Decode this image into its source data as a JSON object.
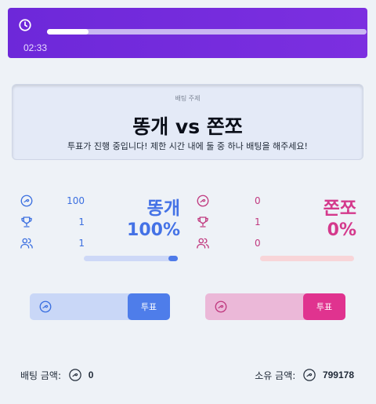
{
  "timer": {
    "remaining": "02:33",
    "progress": 0.13
  },
  "topic": {
    "label": "배팅 주제",
    "title": "똥개 vs 쫀쪼",
    "description": "투표가 진행 중입니다! 제한 시간 내에 둘 중 하나 배팅을 해주세요!"
  },
  "sides": {
    "left": {
      "name": "똥개",
      "percent": "100%",
      "coins": "100",
      "trophies": "1",
      "voters": "1",
      "bar_fraction": 1.0,
      "vote_label": "투표",
      "color": "#4472e6"
    },
    "right": {
      "name": "쫀쪼",
      "percent": "0%",
      "coins": "0",
      "trophies": "1",
      "voters": "0",
      "bar_fraction": 0.0,
      "vote_label": "투표",
      "color": "#d4398c"
    }
  },
  "footer": {
    "bet_label": "배팅 금액:",
    "bet_amount": "0",
    "owned_label": "소유 금액:",
    "owned_amount": "799178"
  },
  "icons": {
    "timer": "clock-icon",
    "coin": "coin-icon",
    "trophy": "trophy-icon",
    "users": "users-icon"
  }
}
